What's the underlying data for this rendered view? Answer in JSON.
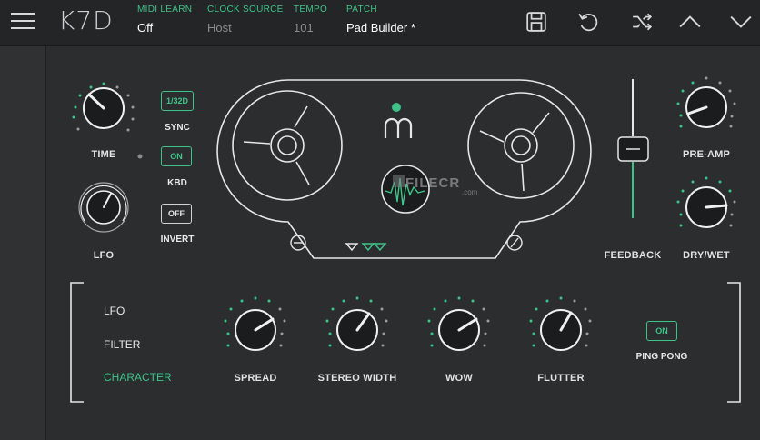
{
  "app": {
    "title": "K7D"
  },
  "header": {
    "midi_learn": {
      "label": "MIDI LEARN",
      "value": "Off"
    },
    "clock_source": {
      "label": "CLOCK SOURCE",
      "value": "Host"
    },
    "tempo": {
      "label": "TEMPO",
      "value": "101"
    },
    "patch": {
      "label": "PATCH",
      "value": "Pad Builder *"
    },
    "icons": [
      "save-icon",
      "undo-icon",
      "shuffle-icon",
      "chevron-up-icon",
      "chevron-down-icon"
    ]
  },
  "controls": {
    "time": {
      "label": "TIME"
    },
    "lfo": {
      "label": "LFO"
    },
    "sync": {
      "value": "1/32D",
      "label": "SYNC"
    },
    "kbd": {
      "value": "ON",
      "label": "KBD"
    },
    "invert": {
      "value": "OFF",
      "label": "INVERT"
    },
    "feedback": {
      "label": "FEEDBACK"
    },
    "pre_amp": {
      "label": "PRE-AMP"
    },
    "dry_wet": {
      "label": "DRY/WET"
    }
  },
  "tabs": [
    {
      "label": "LFO",
      "active": false
    },
    {
      "label": "FILTER",
      "active": false
    },
    {
      "label": "CHARACTER",
      "active": true
    }
  ],
  "character": {
    "spread": {
      "label": "SPREAD"
    },
    "stereo_width": {
      "label": "STEREO WIDTH"
    },
    "wow": {
      "label": "WOW"
    },
    "flutter": {
      "label": "FLUTTER"
    },
    "ping_pong": {
      "value": "ON",
      "label": "PING PONG"
    }
  },
  "watermark": {
    "text": "FILECR",
    "sub": ".com"
  },
  "colors": {
    "accent": "#3ec489",
    "background": "#2b2d2f",
    "topbar": "#232527",
    "line": "#e6e6e6"
  }
}
